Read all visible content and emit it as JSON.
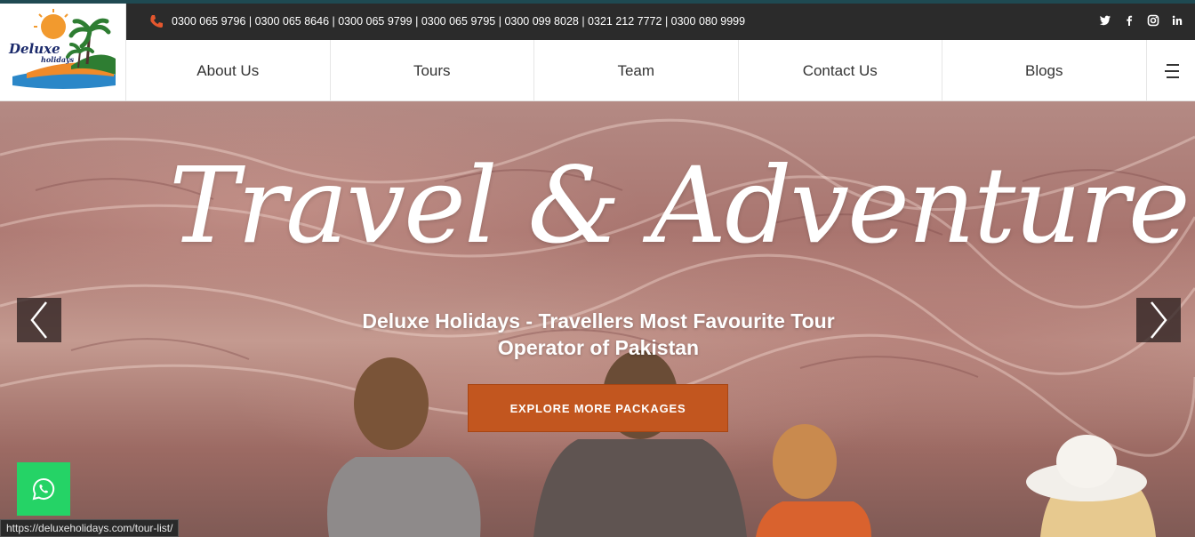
{
  "logo": {
    "line1": "Deluxe",
    "line2": "holidays"
  },
  "topbar": {
    "phones": "0300 065 9796 | 0300 065 8646 | 0300 065 9799 | 0300 065 9795 | 0300 099 8028 | 0321 212 7772 | 0300 080 9999",
    "social_icons": [
      "twitter-icon",
      "facebook-icon",
      "instagram-icon",
      "linkedin-icon"
    ]
  },
  "nav": {
    "items": [
      {
        "label": "About Us"
      },
      {
        "label": "Tours"
      },
      {
        "label": "Team"
      },
      {
        "label": "Contact Us"
      },
      {
        "label": "Blogs"
      }
    ],
    "menu_icon": "hamburger-menu-icon"
  },
  "hero": {
    "title": "Travel & Adventure",
    "subtitle": "Deluxe Holidays - Travellers Most Favourite Tour Operator of Pakistan",
    "cta_label": "EXPLORE MORE PACKAGES"
  },
  "status_url": "https://deluxeholidays.com/tour-list/",
  "colors": {
    "accent": "#c2561f",
    "topbar": "#2b2b2b",
    "whatsapp": "#25d366",
    "phone_icon": "#e4572e"
  }
}
